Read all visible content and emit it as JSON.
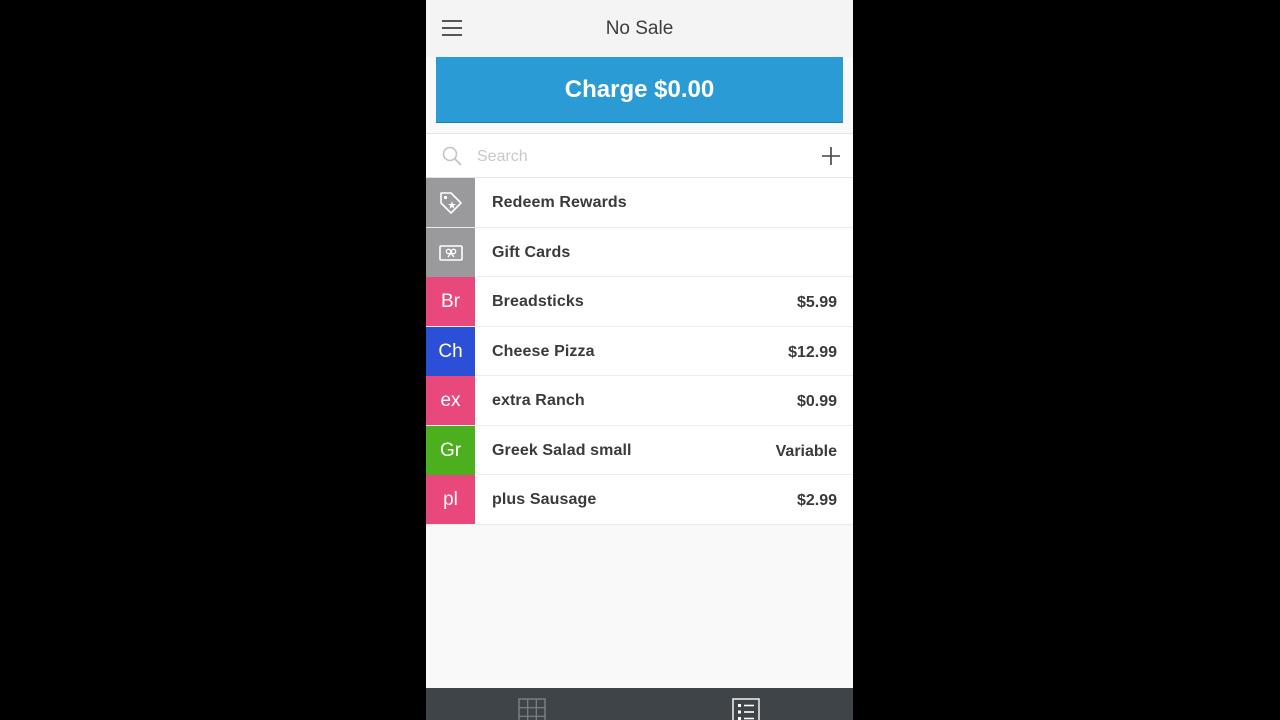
{
  "header": {
    "title": "No Sale",
    "menu_icon": "hamburger-menu-icon"
  },
  "charge": {
    "label": "Charge $0.00",
    "color": "#2b9bd5"
  },
  "search": {
    "placeholder": "Search",
    "value": "",
    "search_icon": "search-icon",
    "add_icon": "plus-icon"
  },
  "items": [
    {
      "tile": "",
      "tile_icon": "reward-tag-icon",
      "tile_color": "#9a9a9d",
      "name": "Redeem Rewards",
      "price": ""
    },
    {
      "tile": "",
      "tile_icon": "gift-card-icon",
      "tile_color": "#9a9a9d",
      "name": "Gift Cards",
      "price": ""
    },
    {
      "tile": "Br",
      "tile_color": "#e8487c",
      "name": "Breadsticks",
      "price": "$5.99"
    },
    {
      "tile": "Ch",
      "tile_color": "#2b4fd6",
      "name": "Cheese Pizza",
      "price": "$12.99"
    },
    {
      "tile": "ex",
      "tile_color": "#e8487c",
      "name": "extra Ranch",
      "price": "$0.99"
    },
    {
      "tile": "Gr",
      "tile_color": "#4caf1e",
      "name": "Greek Salad small",
      "price": "Variable"
    },
    {
      "tile": "pl",
      "tile_color": "#e8487c",
      "name": "plus Sausage",
      "price": "$2.99"
    }
  ],
  "bottom_tabs": [
    {
      "icon": "grid-view-icon"
    },
    {
      "icon": "list-view-icon",
      "active": true
    }
  ]
}
